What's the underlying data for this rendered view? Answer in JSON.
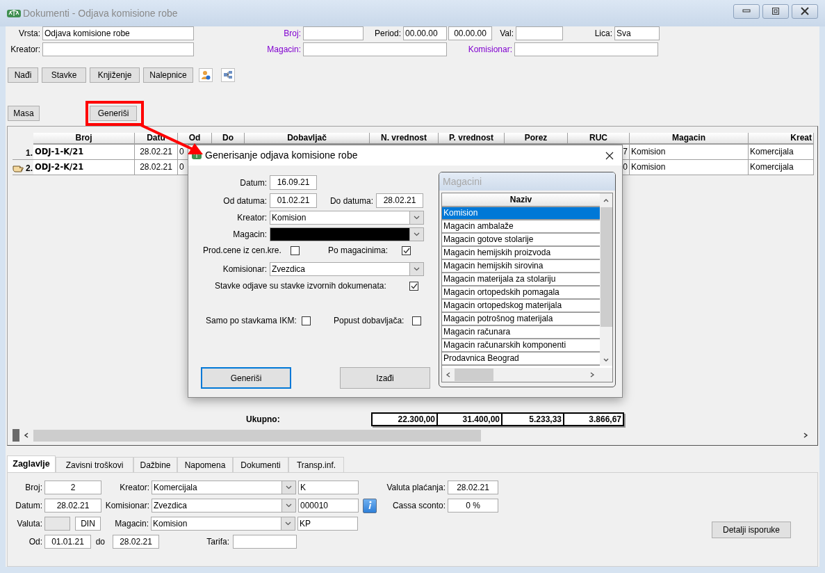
{
  "window": {
    "title": "Dokumenti - Odjava komisione robe"
  },
  "filters": [
    [
      {
        "label": "Vrsta:",
        "highlighted": false,
        "values": [
          "Odjava komisione robe"
        ]
      },
      {
        "label": "Broj:",
        "highlighted": true
      },
      {
        "label": "Period:",
        "highlighted": false,
        "values": [
          "00.00.00",
          "00.00.00"
        ]
      },
      {
        "label": "Val:",
        "highlighted": false
      },
      {
        "label": "Lica:",
        "highlighted": false,
        "values": [
          "Sva"
        ]
      }
    ],
    [
      {
        "label": "Kreator:",
        "highlighted": false
      },
      {
        "label": "Magacin:",
        "highlighted": true
      },
      {
        "label": "Komisionar:",
        "highlighted": true
      }
    ]
  ],
  "toolbar": [
    "Nađi",
    "Stavke",
    "Knjiženje",
    "Nalepnice"
  ],
  "actions": [
    "Masa",
    "Generiši"
  ],
  "grid": {
    "columns": [
      "Broj",
      "Datu",
      "Od",
      "Do",
      "Dobavljač",
      "N. vrednost",
      "P. vrednost",
      "Porez",
      "RUC",
      "Magacin",
      "Kreat"
    ],
    "rows": [
      {
        "number": "1.",
        "current": false,
        "cells": [
          "ODJ-1-K/21",
          "28.02.21",
          "0",
          null,
          null,
          null,
          null,
          null,
          "7",
          "Komision",
          "Komercijala"
        ]
      },
      {
        "number": "2.",
        "current": true,
        "cells": [
          "ODJ-2-K/21",
          "28.02.21",
          "0",
          null,
          null,
          null,
          null,
          null,
          "0",
          "Komision",
          "Komercijala"
        ]
      }
    ]
  },
  "totals": {
    "label": "Ukupno:",
    "values": [
      "22.300,00",
      "31.400,00",
      "5.233,33",
      "3.866,67"
    ]
  },
  "tabs": [
    {
      "label": "Zaglavlje",
      "selected": true
    },
    {
      "label": "Zavisni troškovi",
      "selected": false
    },
    {
      "label": "Dažbine",
      "selected": false
    },
    {
      "label": "Napomena",
      "selected": false
    },
    {
      "label": "Dokumenti",
      "selected": false
    },
    {
      "label": "Transp.inf.",
      "selected": false
    }
  ],
  "header_form": {
    "broj": {
      "label": "Broj:",
      "value": "2"
    },
    "datum": {
      "label": "Datum:",
      "value": "28.02.21"
    },
    "valuta": {
      "label": "Valuta:",
      "disabled": true,
      "currency": "DIN"
    },
    "od": {
      "label": "Od:",
      "value": "01.01.21"
    },
    "do": {
      "label": "do",
      "value": "28.02.21"
    },
    "kreator": {
      "label": "Kreator:",
      "value": "Komercijala",
      "code": "K"
    },
    "komisionar": {
      "label": "Komisionar:",
      "value": "Zvezdica",
      "code": "000010"
    },
    "magacin": {
      "label": "Magacin:",
      "value": "Komision",
      "code": "KP"
    },
    "tarifa": {
      "label": "Tarifa:"
    },
    "valuta_placanja": {
      "label": "Valuta plaćanja:",
      "value": "28.02.21"
    },
    "cassa_sconto": {
      "label": "Cassa sconto:",
      "value": "0 %"
    },
    "button": "Detalji isporuke"
  },
  "dialog": {
    "title": "Generisanje odjava komisione robe",
    "datum": {
      "label": "Datum:",
      "value": "16.09.21"
    },
    "od_datuma": {
      "label": "Od datuma:",
      "value": "01.02.21"
    },
    "do_datuma": {
      "label": "Do datuma:",
      "value": "28.02.21"
    },
    "kreator": {
      "label": "Kreator:",
      "value": "Komision"
    },
    "magacin": {
      "label": "Magacin:",
      "masked": true
    },
    "prod_cene": {
      "label": "Prod.cene iz cen.kre.",
      "checked": false
    },
    "po_magacinima": {
      "label": "Po magacinima:",
      "checked": true
    },
    "komisionar": {
      "label": "Komisionar:",
      "value": "Zvezdica"
    },
    "stavke_odjave": {
      "label": "Stavke odjave su stavke izvornih dokumenata:",
      "checked": true
    },
    "samo_ikm": {
      "label": "Samo po stavkama IKM:",
      "checked": false
    },
    "popust": {
      "label": "Popust dobavljača:",
      "checked": false
    },
    "buttons": [
      {
        "label": "Generiši",
        "focused": true
      },
      {
        "label": "Izađi",
        "focused": false
      }
    ],
    "magacini": {
      "title": "Magacini",
      "column": "Naziv",
      "items": [
        {
          "label": "Komision",
          "selected": true
        },
        {
          "label": "Magacin ambalaže",
          "selected": false
        },
        {
          "label": "Magacin gotove stolarije",
          "selected": false
        },
        {
          "label": "Magacin hemijskih proizvoda",
          "selected": false
        },
        {
          "label": "Magacin hemijskih sirovina",
          "selected": false
        },
        {
          "label": "Magacin materijala za stolariju",
          "selected": false
        },
        {
          "label": "Magacin ortopedskih pomagala",
          "selected": false
        },
        {
          "label": "Magacin ortopedskog materijala",
          "selected": false
        },
        {
          "label": "Magacin potrošnog materijala",
          "selected": false
        },
        {
          "label": "Magacin računara",
          "selected": false
        },
        {
          "label": "Magacin računarskih komponenti",
          "selected": false
        },
        {
          "label": "Prodavnica Beograd",
          "selected": false
        }
      ]
    }
  }
}
